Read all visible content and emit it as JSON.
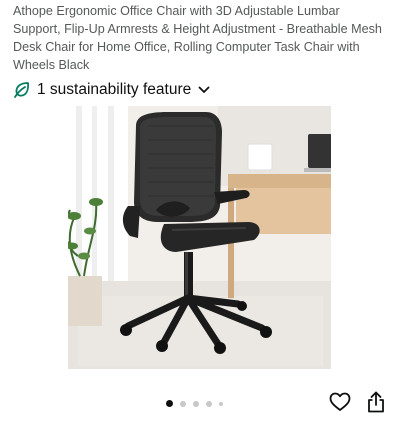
{
  "product": {
    "title": "Athope Ergonomic Office Chair with 3D Adjustable Lumbar Support, Flip-Up Armrests & Height Adjustment - Breathable Mesh Desk Chair for Home Office, Rolling Computer Task Chair with Wheels Black"
  },
  "sustainability": {
    "label": "1 sustainability feature",
    "icon": "leaf-icon",
    "expand_icon": "chevron-down-icon",
    "accent_color": "#067D62"
  },
  "gallery": {
    "image_subject": "black ergonomic mesh office chair in home office",
    "page_count": 5,
    "active_index": 0
  },
  "actions": {
    "wishlist_icon": "heart-icon",
    "share_icon": "share-icon"
  }
}
